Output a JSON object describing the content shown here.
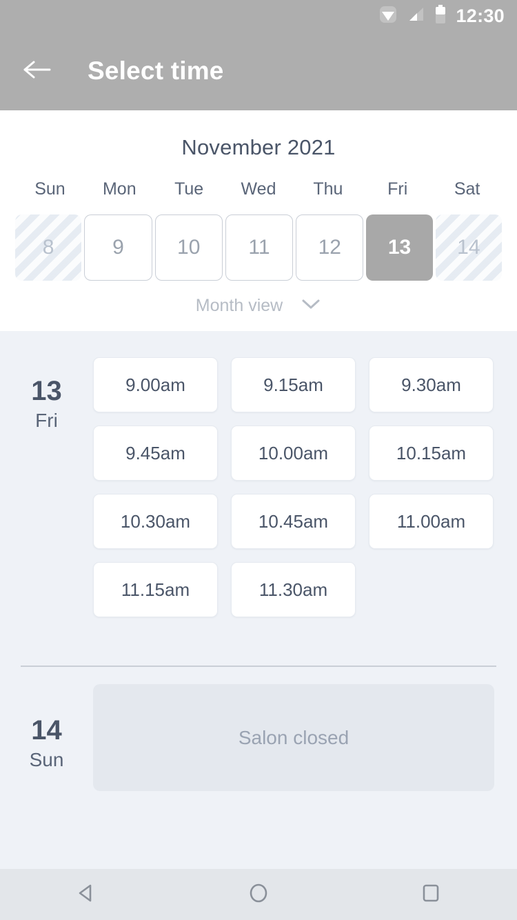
{
  "status_bar": {
    "time": "12:30",
    "icons": [
      "wifi-icon",
      "cellular-signal-icon",
      "battery-icon"
    ]
  },
  "app_bar": {
    "back_icon": "arrow-left-icon",
    "title": "Select time",
    "background_color": "#aeaeae",
    "text_color": "#ffffff"
  },
  "calendar": {
    "month_label": "November 2021",
    "weekdays": [
      "Sun",
      "Mon",
      "Tue",
      "Wed",
      "Thu",
      "Fri",
      "Sat"
    ],
    "days": [
      {
        "number": "8",
        "state": "disabled"
      },
      {
        "number": "9",
        "state": "available"
      },
      {
        "number": "10",
        "state": "available"
      },
      {
        "number": "11",
        "state": "available"
      },
      {
        "number": "12",
        "state": "available"
      },
      {
        "number": "13",
        "state": "selected"
      },
      {
        "number": "14",
        "state": "disabled"
      }
    ],
    "view_toggle": {
      "label": "Month view",
      "icon": "chevron-down-icon"
    },
    "selected_color": "#a8a8a8"
  },
  "schedule": {
    "days": [
      {
        "date_number": "13",
        "date_weekday": "Fri",
        "slots": [
          "9.00am",
          "9.15am",
          "9.30am",
          "9.45am",
          "10.00am",
          "10.15am",
          "10.30am",
          "10.45am",
          "11.00am",
          "11.15am",
          "11.30am"
        ],
        "closed_message": null
      },
      {
        "date_number": "14",
        "date_weekday": "Sun",
        "slots": [],
        "closed_message": "Salon closed"
      }
    ]
  },
  "nav_bar": {
    "buttons": [
      {
        "name": "back-nav",
        "icon": "triangle-left-icon"
      },
      {
        "name": "home-nav",
        "icon": "circle-icon"
      },
      {
        "name": "recents-nav",
        "icon": "square-icon"
      }
    ]
  },
  "colors": {
    "page_background": "#eff2f7",
    "panel_background": "#ffffff",
    "text_primary": "#4a5568",
    "text_muted": "#9aa3b2",
    "closed_panel": "#e4e8ee"
  }
}
